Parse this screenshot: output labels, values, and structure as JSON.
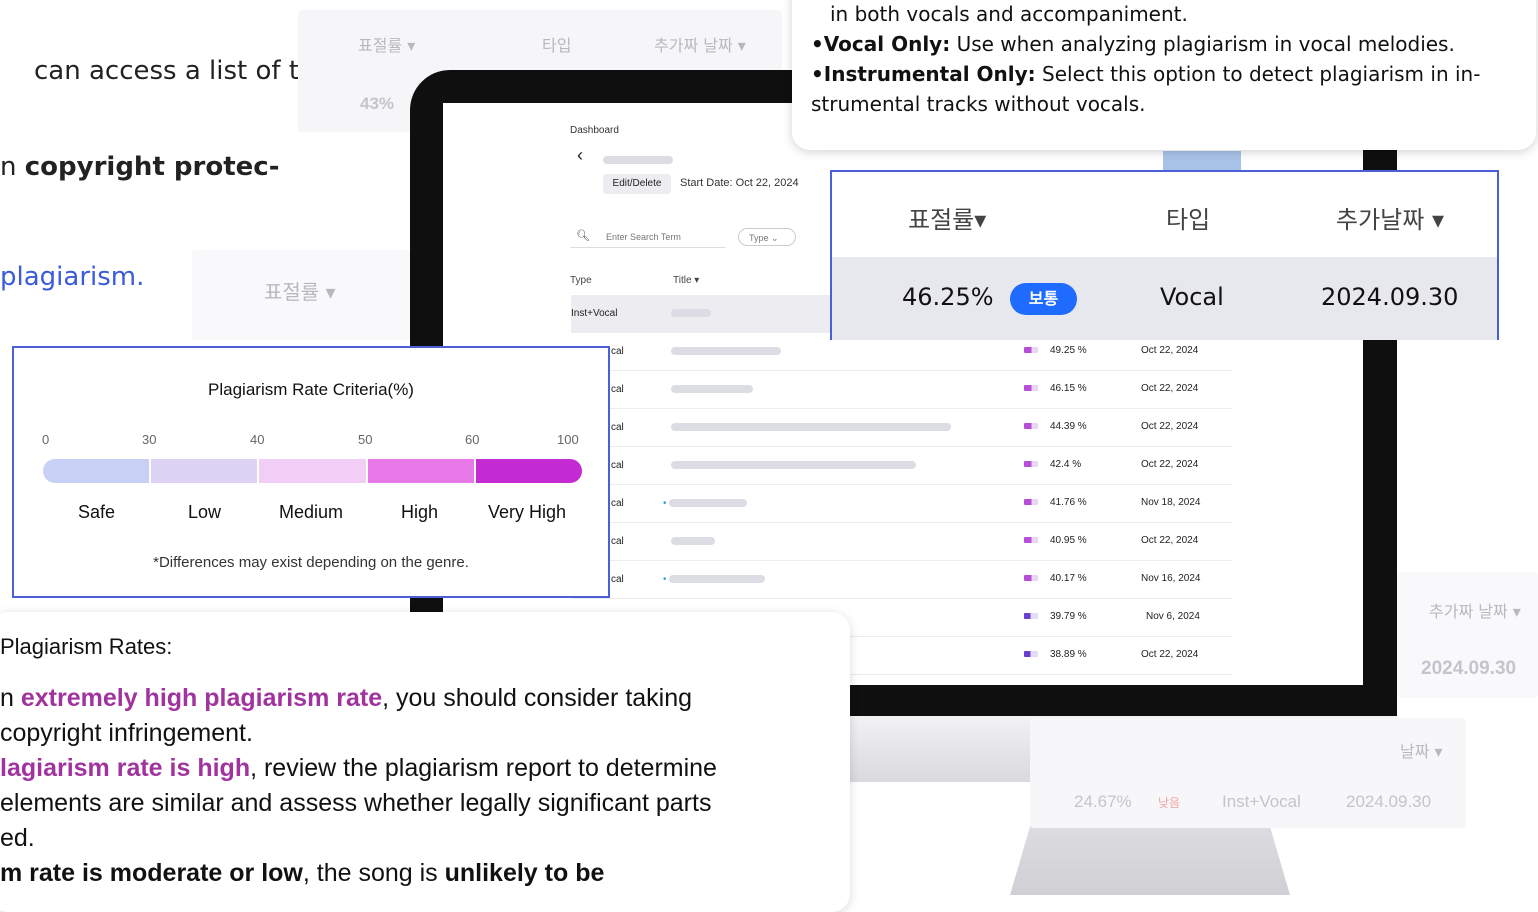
{
  "background": {
    "text_line1": "can access a list of the",
    "text_line2_pre": "n ",
    "text_line2_bold": "copyright protec-",
    "text_line3_link": "plagiarism.",
    "frag_top": {
      "col1": "표절률 ▾",
      "col2": "타입",
      "col3": "추가짜 날짜 ▾",
      "value": "43%"
    },
    "frag_left": {
      "col1": "표절률 ▾"
    },
    "frag_right_bottom": {
      "col": "추가짜 날짜 ▾",
      "value": "2024.09.30"
    },
    "frag_bottom": {
      "col": "날짜 ▾",
      "rate": "24.67%",
      "badge": "낮음",
      "type": "Inst+Vocal",
      "date": "2024.09.30"
    }
  },
  "screen": {
    "breadcrumb": "Dashboard",
    "edit_label": "Edit/Delete",
    "start_date": "Start Date: Oct 22, 2024",
    "search_placeholder": "Enter Search Term",
    "type_filter": "Type",
    "col_type": "Type",
    "col_title": "Title",
    "rows": [
      {
        "type": "Inst+Vocal",
        "rate": "",
        "date": ""
      },
      {
        "type": "cal",
        "rate": "49.25 %",
        "date": "Oct 22, 2024"
      },
      {
        "type": "cal",
        "rate": "46.15 %",
        "date": "Oct 22, 2024"
      },
      {
        "type": "cal",
        "rate": "44.39 %",
        "date": "Oct 22, 2024"
      },
      {
        "type": "cal",
        "rate": "42.4 %",
        "date": "Oct 22, 2024"
      },
      {
        "type": "cal",
        "rate": "41.76 %",
        "date": "Nov 18, 2024"
      },
      {
        "type": "cal",
        "rate": "40.95 %",
        "date": "Oct 22, 2024"
      },
      {
        "type": "cal",
        "rate": "40.17 %",
        "date": "Nov 16, 2024"
      },
      {
        "type": "",
        "rate": "39.79 %",
        "date": "Nov 6, 2024"
      },
      {
        "type": "",
        "rate": "38.89 %",
        "date": "Oct 22, 2024"
      }
    ]
  },
  "criteria": {
    "title": "Plagiarism Rate Criteria(%)",
    "ticks": [
      "0",
      "30",
      "40",
      "50",
      "60",
      "100"
    ],
    "levels": [
      "Safe",
      "Low",
      "Medium",
      "High",
      "Very High"
    ],
    "colors": [
      "#c9d0f6",
      "#dcd3f5",
      "#f2cdf6",
      "#e77ae8",
      "#c42bd2"
    ],
    "note": "*Differences may exist depending on the genre."
  },
  "info": {
    "line1": "in both vocals and accompaniment.",
    "vocal_label": "•Vocal Only:",
    "vocal_text": " Use when analyzing plagiarism in vocal melodies.",
    "inst_label": "•Instrumental Only:",
    "inst_text": " Select this option to detect plagiarism in in-",
    "line4": "strumental tracks without vocals."
  },
  "highlight": {
    "col_rate": "표절률▾",
    "col_type": "타입",
    "col_date": "추가날짜 ▾",
    "rate": "46.25%",
    "badge": "보통",
    "type": "Vocal",
    "date": "2024.09.30"
  },
  "explanation": {
    "heading": "Plagiarism Rates:",
    "l1_pre": "n ",
    "l1_em": "extremely high plagiarism rate",
    "l1_post": ", you should consider taking",
    "l2": "copyright infringement.",
    "l3_em": "lagiarism rate is high",
    "l3_post": ", review the plagiarism report to determine",
    "l4": "elements are similar and assess whether legally significant parts",
    "l5": "ed.",
    "l6_b1": "m rate is moderate or low",
    "l6_mid": ", the song is ",
    "l6_b2": "unlikely to be"
  }
}
